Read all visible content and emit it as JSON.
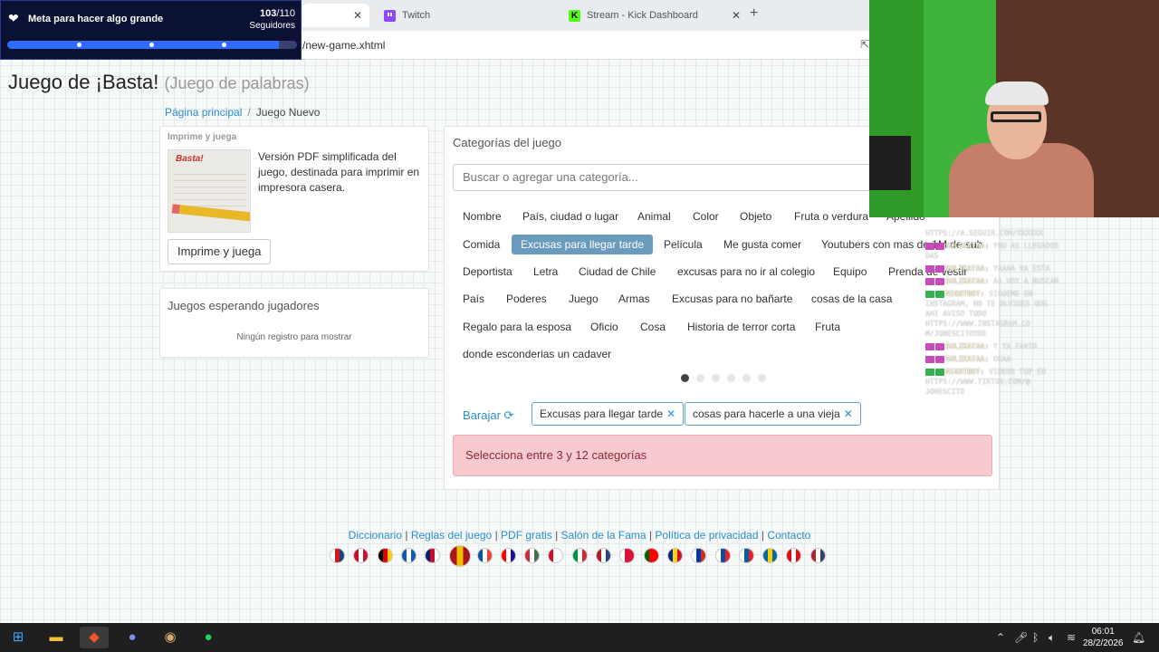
{
  "browser": {
    "tabs": [
      {
        "label": "",
        "active": true
      },
      {
        "label": "Twitch",
        "icon": "twitch-icon"
      },
      {
        "label": "Stream - Kick Dashboard",
        "icon": "kick-icon"
      }
    ],
    "url": "/new-game.xhtml"
  },
  "goal": {
    "title": "Meta para hacer algo grande",
    "count": "103",
    "target": "/110",
    "subtitle": "Seguidores",
    "progress": 0.936
  },
  "page": {
    "title": "Juego de ¡Basta!",
    "subtitle": "(Juego de palabras)"
  },
  "breadcrumb": {
    "home": "Página principal",
    "separator": "/",
    "current": "Juego Nuevo"
  },
  "print_panel": {
    "heading": "Imprime y juega",
    "thumb_logo": "Basta!",
    "description": "Versión PDF simplificada del juego, destinada para imprimir en impresora casera.",
    "button": "Imprime y juega"
  },
  "waiting_panel": {
    "title": "Juegos esperando jugadores",
    "empty": "Ningún registro para mostrar"
  },
  "categories": {
    "title": "Categorías del juego",
    "search_placeholder": "Buscar o agregar una categoría...",
    "tags": [
      "Nombre",
      "País, ciudad o lugar",
      "Animal",
      "Color",
      "Objeto",
      "Fruta o verdura",
      "Apellido",
      "Comida",
      "Excusas para llegar tarde",
      "Película",
      "Me gusta comer",
      "Youtubers con mas de 1M de sub",
      "Deportista",
      "Letra",
      "Ciudad de Chile",
      "excusas para no ir al colegio",
      "Equipo",
      "Prenda de vestir",
      "País",
      "Poderes",
      "Juego",
      "Armas",
      "Excusas para no bañarte",
      "cosas de la casa",
      "Regalo para la esposa",
      "Oficio",
      "Cosa",
      "Historia de terror corta",
      "Fruta",
      "donde esconderias un cadaver"
    ],
    "selected_tag": "Excusas para llegar tarde",
    "pages": 6,
    "current_page": 1,
    "shuffle_label": "Barajar",
    "chips": [
      "Excusas para llegar tarde",
      "cosas para hacerle a una vieja"
    ],
    "alert": "Selecciona entre 3 y 12 categorías"
  },
  "footer": {
    "links": [
      "Diccionario",
      "Reglas del juego",
      "PDF gratis",
      "Salón de la Fama",
      "Política de privacidad",
      "Contacto"
    ],
    "separator": "|",
    "flags": [
      "czech",
      "denmark",
      "germany",
      "greece",
      "uk",
      "spain",
      "france",
      "croatia",
      "hungary",
      "indonesia",
      "italy",
      "netherlands",
      "poland",
      "portugal",
      "romania",
      "russia",
      "slovakia",
      "slovenia",
      "sweden",
      "turkey",
      "usa"
    ]
  },
  "chat": [
    {
      "user": "",
      "msg": "HTTPS://A.SEGUIR.COM/XXXXXX"
    },
    {
      "user": "SULIKATAA:",
      "msg": "YOU AS LLEGADOS DAS",
      "badge": "pink"
    },
    {
      "user": "SULIKATAA:",
      "msg": "YAAAA VA ESTA",
      "badge": "pink"
    },
    {
      "user": "SULIKATAA:",
      "msg": "AA VOY A BUSCAR",
      "badge": "pink"
    },
    {
      "user": "NIGHTBOT:",
      "msg": "SIGUEME EN INSTAGRAM, NO TE OLVIDES QUE AHI AVISO TODO HTTPS://WWW.INSTAGRAM.CO M/JONESCITOXDE",
      "badge": "green"
    },
    {
      "user": "SULIKATAA:",
      "msg": "Y YA FAVIO",
      "badge": "pink"
    },
    {
      "user": "SULIKATAA:",
      "msg": "OKAA",
      "badge": "pink"
    },
    {
      "user": "NIGHTBOT:",
      "msg": "VIDEOS TOP EN HTTPS://WWW.TIKTOK.COM/@ JONESCITO",
      "badge": "green"
    }
  ],
  "taskbar": {
    "time": "06:01",
    "date": "28/2/2026"
  }
}
